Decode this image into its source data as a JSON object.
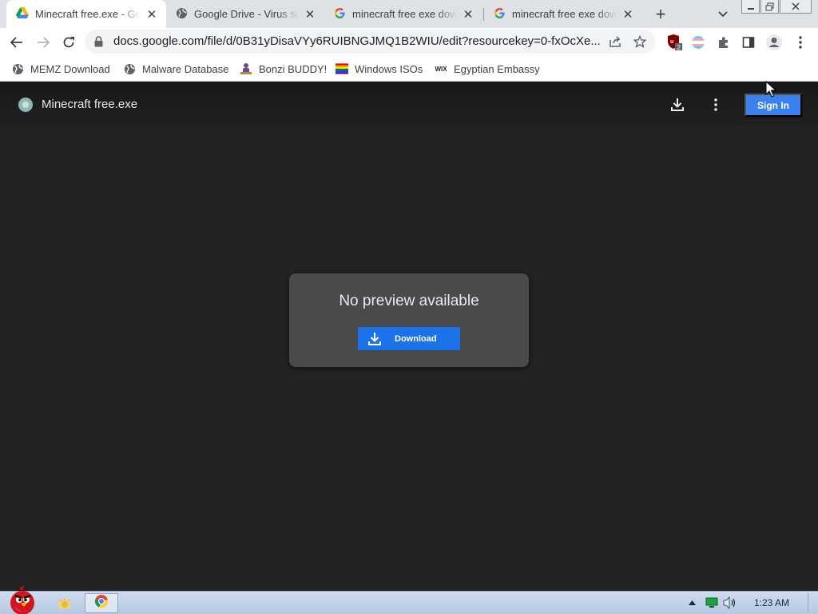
{
  "browser": {
    "tabs": [
      {
        "title": "Minecraft free.exe - Google Drive",
        "favicon": "google-drive-icon",
        "active": true
      },
      {
        "title": "Google Drive - Virus scan warning",
        "favicon": "globe-icon",
        "active": false
      },
      {
        "title": "minecraft free exe download",
        "favicon": "google-g-icon",
        "active": false
      },
      {
        "title": "minecraft free exe download",
        "favicon": "google-g-icon",
        "active": false
      }
    ],
    "new_tab_label": "+",
    "close_glyph": "✕",
    "url": "docs.google.com/file/d/0B31yDisaVYy6RUIBNGJMQ1B2WIU/edit?resourcekey=0-fxOcXe...",
    "extension_badge": "2",
    "bookmarks": [
      {
        "label": "MEMZ Download",
        "icon": "globe-icon"
      },
      {
        "label": "Malware Database",
        "icon": "globe-icon"
      },
      {
        "label": "Bonzi BUDDY!",
        "icon": "bonzi-icon"
      },
      {
        "label": "Windows ISOs",
        "icon": "rainbow-flag-icon"
      },
      {
        "label": "Egyptian Embassy",
        "icon": "wix-icon"
      }
    ],
    "wix_text": "WIX"
  },
  "viewer": {
    "file_name": "Minecraft free.exe",
    "sign_in_label": "Sign In",
    "no_preview_message": "No preview available",
    "download_label": "Download"
  },
  "taskbar": {
    "time": "1:23 AM"
  },
  "colors": {
    "accent_blue": "#1a73e8",
    "sign_in_blue": "#3b82f0",
    "viewer_bg": "#232323",
    "dialog_bg": "#4a4a4d"
  }
}
